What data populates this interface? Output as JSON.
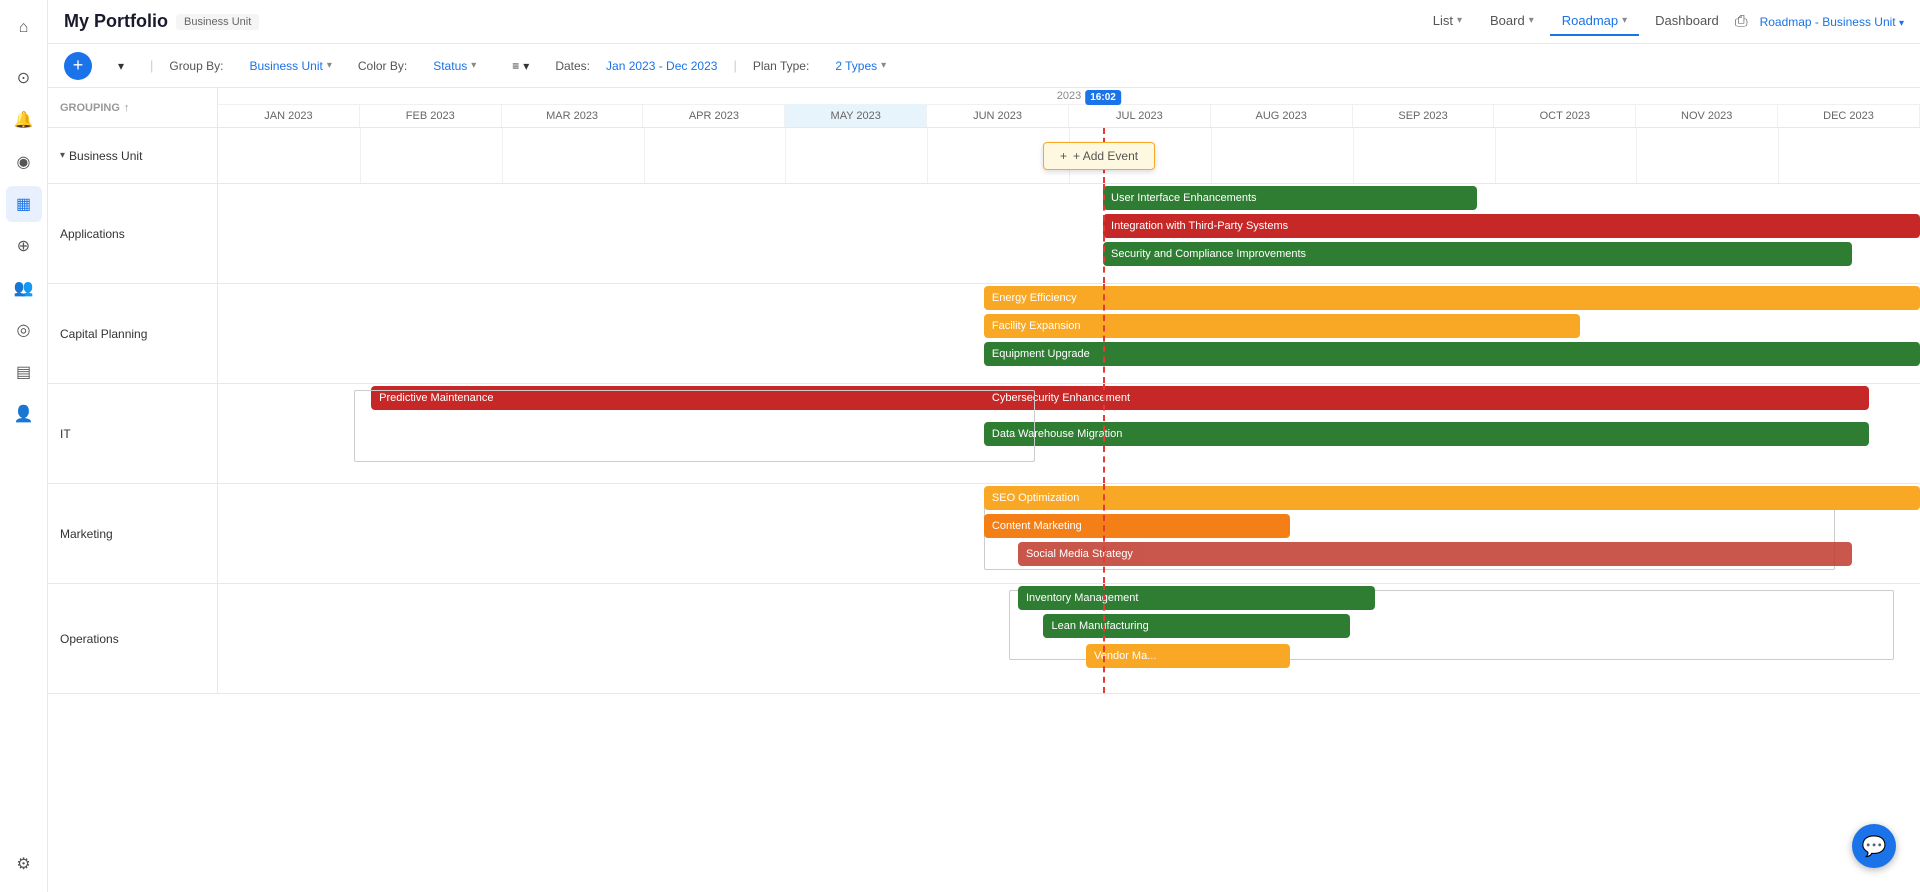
{
  "app": {
    "title": "My Portfolio",
    "subtitle": "Business Unit"
  },
  "top_nav": {
    "items": [
      {
        "id": "list",
        "label": "List",
        "active": false
      },
      {
        "id": "board",
        "label": "Board",
        "active": false
      },
      {
        "id": "roadmap",
        "label": "Roadmap",
        "active": true
      },
      {
        "id": "dashboard",
        "label": "Dashboard",
        "active": false
      }
    ],
    "roadmap_label": "Roadmap - Business Unit"
  },
  "toolbar": {
    "add_label": "+",
    "group_by_label": "Group By:",
    "group_by_value": "Business Unit",
    "color_by_label": "Color By:",
    "color_by_value": "Status",
    "dates_label": "Dates:",
    "dates_value": "Jan 2023 - Dec 2023",
    "plan_type_label": "Plan Type:",
    "plan_type_value": "2 Types"
  },
  "gantt": {
    "grouping_label": "GROUPING",
    "year": "2023",
    "months": [
      "JAN 2023",
      "FEB 2023",
      "MAR 2023",
      "APR 2023",
      "MAY 2023",
      "JUN 2023",
      "JUL 2023",
      "AUG 2023",
      "SEP 2023",
      "OCT 2023",
      "NOV 2023",
      "DEC 2023"
    ],
    "today_badge": "16:02",
    "today_position_pct": 52.5,
    "groups": [
      {
        "id": "bu",
        "label": "Business Unit",
        "collapsed": false,
        "indent": true,
        "add_event": "+ Add Event"
      },
      {
        "id": "applications",
        "label": "Applications",
        "bars": [
          {
            "id": "ui",
            "label": "User Interface Enhancements",
            "color": "green",
            "start_pct": 52.0,
            "width_pct": 22.0
          },
          {
            "id": "integration",
            "label": "Integration with Third-Party Systems",
            "color": "red",
            "start_pct": 52.0,
            "width_pct": 48.0
          },
          {
            "id": "security",
            "label": "Security and Compliance Improvements",
            "color": "green",
            "start_pct": 52.0,
            "width_pct": 44.0
          }
        ]
      },
      {
        "id": "capital",
        "label": "Capital Planning",
        "bars": [
          {
            "id": "energy",
            "label": "Energy Efficiency",
            "color": "yellow",
            "start_pct": 45.0,
            "width_pct": 55.0
          },
          {
            "id": "facility",
            "label": "Facility Expansion",
            "color": "yellow",
            "start_pct": 45.0,
            "width_pct": 55.0
          },
          {
            "id": "equipment",
            "label": "Equipment Upgrade",
            "color": "green",
            "start_pct": 45.0,
            "width_pct": 55.0
          }
        ]
      },
      {
        "id": "it",
        "label": "IT",
        "bars": [
          {
            "id": "predictive",
            "label": "Predictive Maintenance",
            "color": "red",
            "start_pct": 9.0,
            "width_pct": 38.0
          },
          {
            "id": "cybersecurity",
            "label": "Cybersecurity Enhancement",
            "color": "red",
            "start_pct": 45.0,
            "width_pct": 52.0
          },
          {
            "id": "data_warehouse",
            "label": "Data Warehouse Migration",
            "color": "green",
            "start_pct": 45.0,
            "width_pct": 52.0
          }
        ]
      },
      {
        "id": "marketing",
        "label": "Marketing",
        "bars": [
          {
            "id": "seo",
            "label": "SEO Optimization",
            "color": "yellow",
            "start_pct": 45.0,
            "width_pct": 55.0
          },
          {
            "id": "content",
            "label": "Content Marketing",
            "color": "orange",
            "start_pct": 45.0,
            "width_pct": 18.0
          },
          {
            "id": "social",
            "label": "Social Media Strategy",
            "color": "pink",
            "start_pct": 47.0,
            "width_pct": 49.0
          }
        ]
      },
      {
        "id": "operations",
        "label": "Operations",
        "bars": [
          {
            "id": "inventory",
            "label": "Inventory Management",
            "color": "green",
            "start_pct": 47.0,
            "width_pct": 21.0
          },
          {
            "id": "lean",
            "label": "Lean Manufacturing",
            "color": "green",
            "start_pct": 48.5,
            "width_pct": 18.0
          },
          {
            "id": "vendor",
            "label": "Vendor Ma...",
            "color": "yellow",
            "start_pct": 51.0,
            "width_pct": 12.0
          }
        ]
      }
    ]
  },
  "icons": {
    "home": "⌂",
    "search": "⊙",
    "bell": "🔔",
    "location": "◉",
    "chart": "▦",
    "globe": "⊕",
    "team": "👥",
    "target": "◎",
    "grid": "▤",
    "person": "👤",
    "settings": "⚙",
    "chevron_down": "▾",
    "chevron_right": "▸",
    "filter": "≡",
    "print": "⎙",
    "chat": "💬",
    "sort": "↑"
  }
}
